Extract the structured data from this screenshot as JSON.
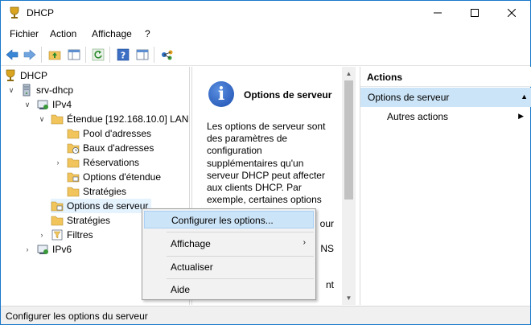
{
  "window": {
    "title": "DHCP"
  },
  "menubar": {
    "items": [
      "Fichier",
      "Action",
      "Affichage",
      "?"
    ]
  },
  "tree": {
    "root": "DHCP",
    "server": "srv-dhcp",
    "ipv4": "IPv4",
    "scope": "Étendue [192.168.10.0] LAN",
    "pool": "Pool d'adresses",
    "leases": "Baux d'adresses",
    "reservations": "Réservations",
    "scope_options": "Options d'étendue",
    "scope_policies": "Stratégies",
    "server_options": "Options de serveur",
    "policies": "Stratégies",
    "filters": "Filtres",
    "ipv6": "IPv6"
  },
  "middle": {
    "title": "Options de serveur",
    "desc_lines": [
      "Les options de serveur sont",
      "des paramètres de",
      "configuration",
      "supplémentaires qu'un",
      "serveur DHCP peut affecter",
      "aux clients DHCP. Par",
      "exemple, certaines options",
      "",
      "our",
      "",
      "NS",
      "",
      "",
      "nt"
    ]
  },
  "actions": {
    "header": "Actions",
    "section": "Options de serveur",
    "item": "Autres actions"
  },
  "context_menu": {
    "configure": "Configurer les options...",
    "view": "Affichage",
    "refresh": "Actualiser",
    "help": "Aide"
  },
  "status": {
    "text": "Configurer les options du serveur"
  },
  "colors": {
    "selection": "#cce4f7",
    "folder": "#f2c55c",
    "accent": "#1979ca"
  }
}
